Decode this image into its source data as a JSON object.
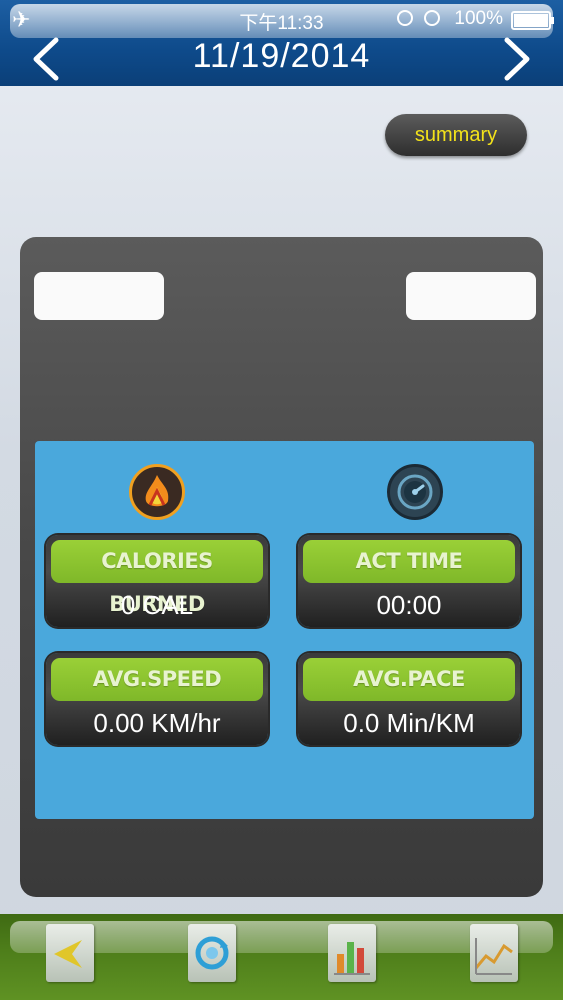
{
  "status_bar": {
    "time": "下午11:33",
    "battery": "100%"
  },
  "header": {
    "date": "11/19/2014"
  },
  "summary_button": {
    "label": "summary"
  },
  "stats": {
    "calories": {
      "label": "CALORIES BURNED",
      "value": "0  CAL"
    },
    "act_time": {
      "label": "ACT TIME",
      "value": "00:00"
    },
    "avg_speed": {
      "label": "AVG.SPEED",
      "value": "0.00  KM/hr"
    },
    "avg_pace": {
      "label": "AVG.PACE",
      "value": "0.0  Min/KM"
    }
  },
  "icons": [
    "airplane-icon",
    "lock-icon",
    "alarm-icon",
    "battery-icon",
    "chevron-left-icon",
    "chevron-right-icon",
    "flame-icon",
    "gauge-icon",
    "back-arrow-icon",
    "sync-icon",
    "bar-chart-icon",
    "line-chart-icon"
  ],
  "colors": {
    "header_blue": "#0e4a8a",
    "panel_blue": "#4aa8dc",
    "label_green": "#8cc432",
    "summary_text": "#f3e21a",
    "toolbar_green": "#4d7d1a"
  }
}
